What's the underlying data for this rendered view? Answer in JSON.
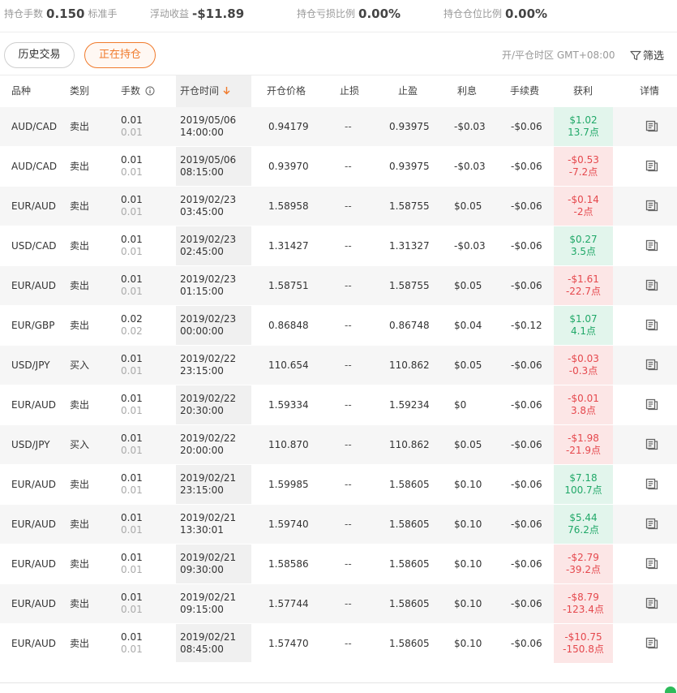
{
  "summary": {
    "lots_label": "持仓手数",
    "lots_value": "0.150",
    "lots_unit": "标准手",
    "float_label": "浮动收益",
    "float_value": "-$11.89",
    "loss_ratio_label": "持仓亏损比例",
    "loss_ratio_value": "0.00%",
    "position_ratio_label": "持仓仓位比例",
    "position_ratio_value": "0.00%"
  },
  "tabs": {
    "history": "历史交易",
    "open": "正在持仓"
  },
  "timezone": "开/平仓时区 GMT+08:00",
  "filter_label": "筛选",
  "columns": {
    "symbol": "品种",
    "side": "类别",
    "lots": "手数",
    "time": "开仓时间",
    "price": "开仓价格",
    "sl": "止损",
    "tp": "止盈",
    "interest": "利息",
    "fee": "手续费",
    "profit": "获利",
    "detail": "详情"
  },
  "colors": {
    "accent": "#f07a2b",
    "profit_positive": "#20a868",
    "profit_negative": "#e5484d"
  },
  "icons": {
    "lots_info": "info-circle-icon",
    "sort": "arrow-down-icon",
    "filter": "filter-icon",
    "detail": "document-icon"
  },
  "rows": [
    {
      "symbol": "AUD/CAD",
      "side": "卖出",
      "lots": "0.01",
      "lots_sub": "0.01",
      "date": "2019/05/06",
      "time": "14:00:00",
      "price": "0.94179",
      "sl": "--",
      "tp": "0.93975",
      "interest": "-$0.03",
      "fee": "-$0.06",
      "profit": "$1.02",
      "points": "13.7点",
      "positive": true
    },
    {
      "symbol": "AUD/CAD",
      "side": "卖出",
      "lots": "0.01",
      "lots_sub": "0.01",
      "date": "2019/05/06",
      "time": "08:15:00",
      "price": "0.93970",
      "sl": "--",
      "tp": "0.93975",
      "interest": "-$0.03",
      "fee": "-$0.06",
      "profit": "-$0.53",
      "points": "-7.2点",
      "positive": false
    },
    {
      "symbol": "EUR/AUD",
      "side": "卖出",
      "lots": "0.01",
      "lots_sub": "0.01",
      "date": "2019/02/23",
      "time": "03:45:00",
      "price": "1.58958",
      "sl": "--",
      "tp": "1.58755",
      "interest": "$0.05",
      "fee": "-$0.06",
      "profit": "-$0.14",
      "points": "-2点",
      "positive": false
    },
    {
      "symbol": "USD/CAD",
      "side": "卖出",
      "lots": "0.01",
      "lots_sub": "0.01",
      "date": "2019/02/23",
      "time": "02:45:00",
      "price": "1.31427",
      "sl": "--",
      "tp": "1.31327",
      "interest": "-$0.03",
      "fee": "-$0.06",
      "profit": "$0.27",
      "points": "3.5点",
      "positive": true
    },
    {
      "symbol": "EUR/AUD",
      "side": "卖出",
      "lots": "0.01",
      "lots_sub": "0.01",
      "date": "2019/02/23",
      "time": "01:15:00",
      "price": "1.58751",
      "sl": "--",
      "tp": "1.58755",
      "interest": "$0.05",
      "fee": "-$0.06",
      "profit": "-$1.61",
      "points": "-22.7点",
      "positive": false
    },
    {
      "symbol": "EUR/GBP",
      "side": "卖出",
      "lots": "0.02",
      "lots_sub": "0.02",
      "date": "2019/02/23",
      "time": "00:00:00",
      "price": "0.86848",
      "sl": "--",
      "tp": "0.86748",
      "interest": "$0.04",
      "fee": "-$0.12",
      "profit": "$1.07",
      "points": "4.1点",
      "positive": true
    },
    {
      "symbol": "USD/JPY",
      "side": "买入",
      "lots": "0.01",
      "lots_sub": "0.01",
      "date": "2019/02/22",
      "time": "23:15:00",
      "price": "110.654",
      "sl": "--",
      "tp": "110.862",
      "interest": "$0.05",
      "fee": "-$0.06",
      "profit": "-$0.03",
      "points": "-0.3点",
      "positive": false
    },
    {
      "symbol": "EUR/AUD",
      "side": "卖出",
      "lots": "0.01",
      "lots_sub": "0.01",
      "date": "2019/02/22",
      "time": "20:30:00",
      "price": "1.59334",
      "sl": "--",
      "tp": "1.59234",
      "interest": "$0",
      "fee": "-$0.06",
      "profit": "-$0.01",
      "points": "3.8点",
      "positive": false
    },
    {
      "symbol": "USD/JPY",
      "side": "买入",
      "lots": "0.01",
      "lots_sub": "0.01",
      "date": "2019/02/22",
      "time": "20:00:00",
      "price": "110.870",
      "sl": "--",
      "tp": "110.862",
      "interest": "$0.05",
      "fee": "-$0.06",
      "profit": "-$1.98",
      "points": "-21.9点",
      "positive": false
    },
    {
      "symbol": "EUR/AUD",
      "side": "卖出",
      "lots": "0.01",
      "lots_sub": "0.01",
      "date": "2019/02/21",
      "time": "23:15:00",
      "price": "1.59985",
      "sl": "--",
      "tp": "1.58605",
      "interest": "$0.10",
      "fee": "-$0.06",
      "profit": "$7.18",
      "points": "100.7点",
      "positive": true
    },
    {
      "symbol": "EUR/AUD",
      "side": "卖出",
      "lots": "0.01",
      "lots_sub": "0.01",
      "date": "2019/02/21",
      "time": "13:30:01",
      "price": "1.59740",
      "sl": "--",
      "tp": "1.58605",
      "interest": "$0.10",
      "fee": "-$0.06",
      "profit": "$5.44",
      "points": "76.2点",
      "positive": true
    },
    {
      "symbol": "EUR/AUD",
      "side": "卖出",
      "lots": "0.01",
      "lots_sub": "0.01",
      "date": "2019/02/21",
      "time": "09:30:00",
      "price": "1.58586",
      "sl": "--",
      "tp": "1.58605",
      "interest": "$0.10",
      "fee": "-$0.06",
      "profit": "-$2.79",
      "points": "-39.2点",
      "positive": false
    },
    {
      "symbol": "EUR/AUD",
      "side": "卖出",
      "lots": "0.01",
      "lots_sub": "0.01",
      "date": "2019/02/21",
      "time": "09:15:00",
      "price": "1.57744",
      "sl": "--",
      "tp": "1.58605",
      "interest": "$0.10",
      "fee": "-$0.06",
      "profit": "-$8.79",
      "points": "-123.4点",
      "positive": false
    },
    {
      "symbol": "EUR/AUD",
      "side": "卖出",
      "lots": "0.01",
      "lots_sub": "0.01",
      "date": "2019/02/21",
      "time": "08:45:00",
      "price": "1.57470",
      "sl": "--",
      "tp": "1.58605",
      "interest": "$0.10",
      "fee": "-$0.06",
      "profit": "-$10.75",
      "points": "-150.8点",
      "positive": false
    }
  ]
}
